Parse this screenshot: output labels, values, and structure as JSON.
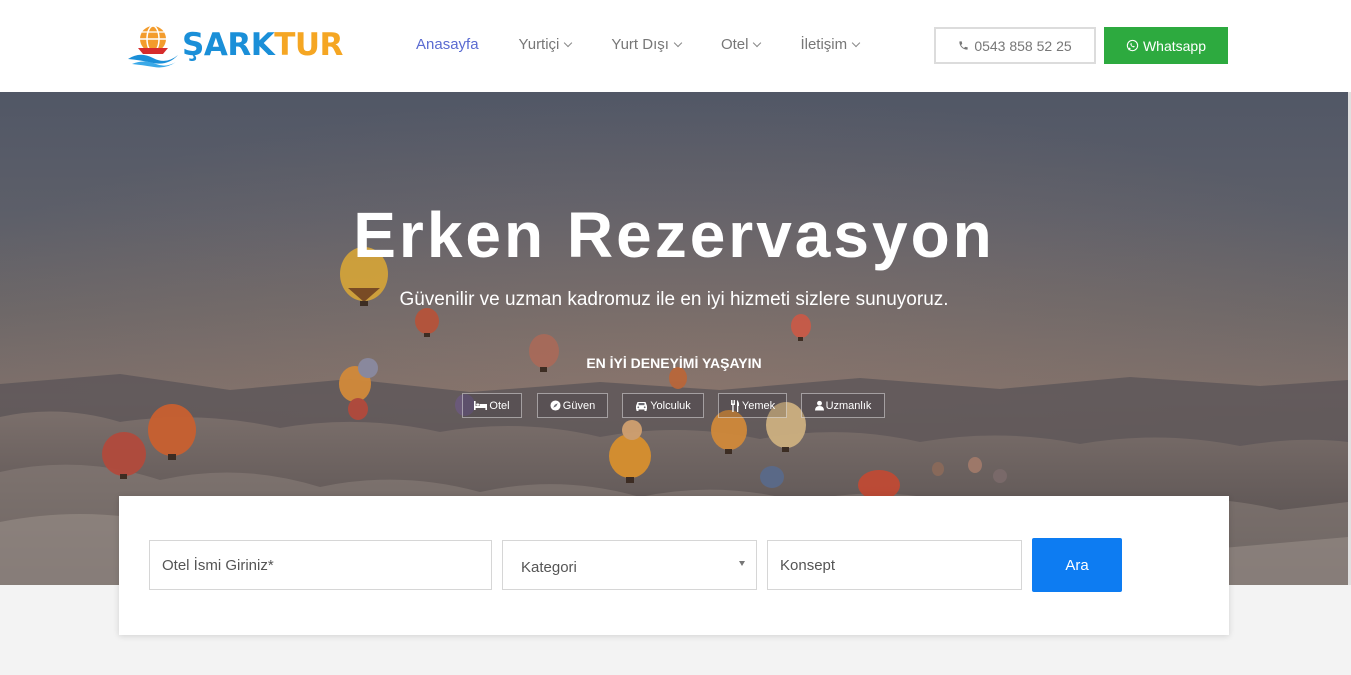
{
  "brand": {
    "part1": "ŞARK",
    "part2": "TUR"
  },
  "nav": {
    "items": [
      {
        "label": "Anasayfa",
        "active": true,
        "dropdown": false
      },
      {
        "label": "Yurtiçi",
        "dropdown": true
      },
      {
        "label": "Yurt Dışı",
        "dropdown": true
      },
      {
        "label": "Otel",
        "dropdown": true
      },
      {
        "label": "İletişim",
        "dropdown": true
      }
    ]
  },
  "contact": {
    "phone": "0543 858 52 25",
    "whatsapp": "Whatsapp"
  },
  "hero": {
    "title": "Erken Rezervasyon",
    "subtitle": "Güvenilir ve uzman kadromuz ile en iyi hizmeti sizlere sunuyoruz.",
    "tagline": "EN İYİ DENEYİMİ YAŞAYIN",
    "chips": [
      {
        "label": "Otel",
        "icon": "bed-icon"
      },
      {
        "label": "Güven",
        "icon": "compass-icon"
      },
      {
        "label": "Yolculuk",
        "icon": "car-icon"
      },
      {
        "label": "Yemek",
        "icon": "cutlery-icon"
      },
      {
        "label": "Uzmanlık",
        "icon": "user-icon"
      }
    ]
  },
  "search": {
    "hotel_placeholder": "Otel İsmi Giriniz*",
    "category_selected": "Kategori",
    "concept_placeholder": "Konsept",
    "submit_label": "Ara"
  },
  "colors": {
    "brand_blue": "#1a8fd8",
    "brand_orange": "#f5a623",
    "nav_active": "#5a6bd1",
    "whatsapp_green": "#2daa3f",
    "search_button": "#0d7cf2"
  }
}
